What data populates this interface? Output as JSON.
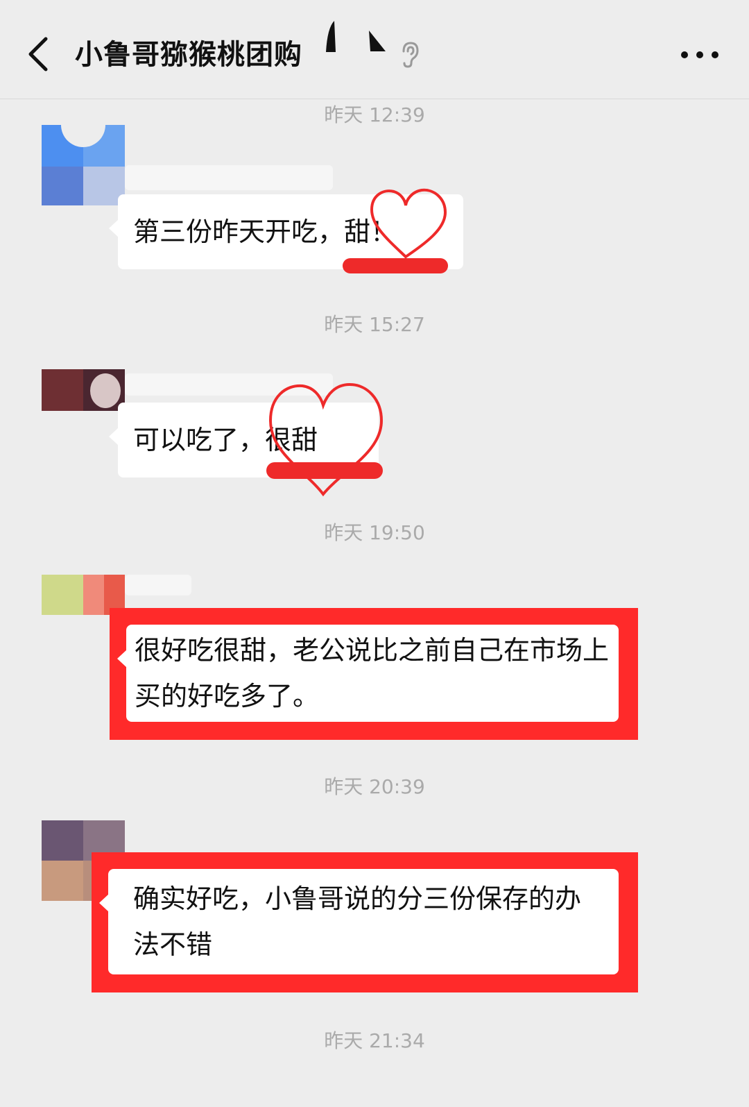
{
  "header": {
    "title": "小鲁哥猕猴桃团购",
    "back_icon": "chevron-left-icon",
    "mute_icon": "ear-icon",
    "more_icon": "more-dots-icon"
  },
  "timestamps": [
    "昨天 12:39",
    "昨天 15:27",
    "昨天 19:50",
    "昨天 20:39",
    "昨天 21:34"
  ],
  "messages": [
    {
      "text": "第三份昨天开吃，甜！"
    },
    {
      "text": "可以吃了，很甜"
    },
    {
      "text": "很好吃很甜，老公说比之前自己在市场上买的好吃多了。"
    },
    {
      "text": "确实好吃，小鲁哥说的分三份保存的办法不错"
    }
  ],
  "colors": {
    "background": "#ededed",
    "bubble": "#ffffff",
    "highlight_red": "#ff2a2a",
    "timestamp": "#aaaaaa"
  }
}
